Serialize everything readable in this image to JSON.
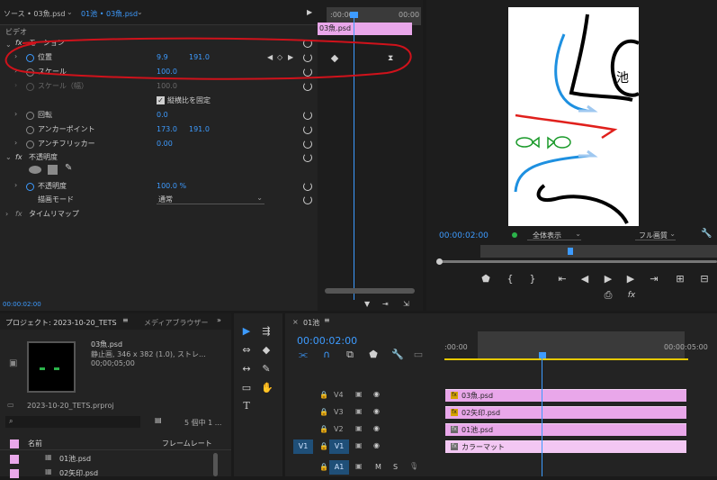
{
  "source_panel": {
    "source_tab": "ソース • 03魚.psd",
    "seq_tab": "01池 • 03魚.psd",
    "video_section": "ビデオ",
    "motion_label": "モーション",
    "timeline_clip": "03魚.psd",
    "tc_left": ":00:00",
    "tc_right": "00:00",
    "time": "00:00:02:00",
    "properties": {
      "position": {
        "label": "位置",
        "x": "9.9",
        "y": "191.0"
      },
      "scale": {
        "label": "スケール",
        "value": "100.0"
      },
      "scale_width": {
        "label": "スケール（幅）",
        "value": "100.0"
      },
      "uniform_scale": "縦横比を固定",
      "rotation": {
        "label": "回転",
        "value": "0.0"
      },
      "anchor": {
        "label": "アンカーポイント",
        "x": "173.0",
        "y": "191.0"
      },
      "flicker": {
        "label": "アンチフリッカー",
        "value": "0.00"
      },
      "opacity_section": "不透明度",
      "opacity": {
        "label": "不透明度",
        "value": "100.0 %"
      },
      "blend_mode": {
        "label": "描画モード",
        "value": "通常"
      },
      "time_remap": "タイムリマップ"
    }
  },
  "program_monitor": {
    "timecode": "00:00:02:00",
    "view_select": "全体表示",
    "quality_select": "フル画質",
    "kanji_label": "池"
  },
  "project_panel": {
    "tab_project": "プロジェクト: 2023-10-20_TETS",
    "tab_media": "メディアブラウザー",
    "clip_name": "03魚.psd",
    "clip_info1": "静止画, 346 x 382 (1.0), ストレ...",
    "clip_info2": "00;00;05;00",
    "project_file": "2023-10-20_TETS.prproj",
    "count": "5 個中 1 ...",
    "col_name": "名前",
    "col_framerate": "フレームレート",
    "items": [
      "01池.psd",
      "02矢印.psd"
    ]
  },
  "timeline": {
    "tab": "01池",
    "timecode": "00:00:02:00",
    "ruler_start": ":00:00",
    "ruler_end": "00:00:05:00",
    "tracks": [
      {
        "name": "V4",
        "clip": "03魚.psd"
      },
      {
        "name": "V3",
        "clip": "02矢印.psd"
      },
      {
        "name": "V2",
        "clip": "01池.psd"
      },
      {
        "name": "V1",
        "clip": "カラーマット"
      }
    ],
    "audio_track": "A1",
    "src_v1": "V1",
    "mute": "M",
    "solo": "S"
  },
  "colors": {
    "accent": "#3d9bff",
    "clip_pink": "#e9a7ea",
    "annotation_red": "#d0121b"
  }
}
